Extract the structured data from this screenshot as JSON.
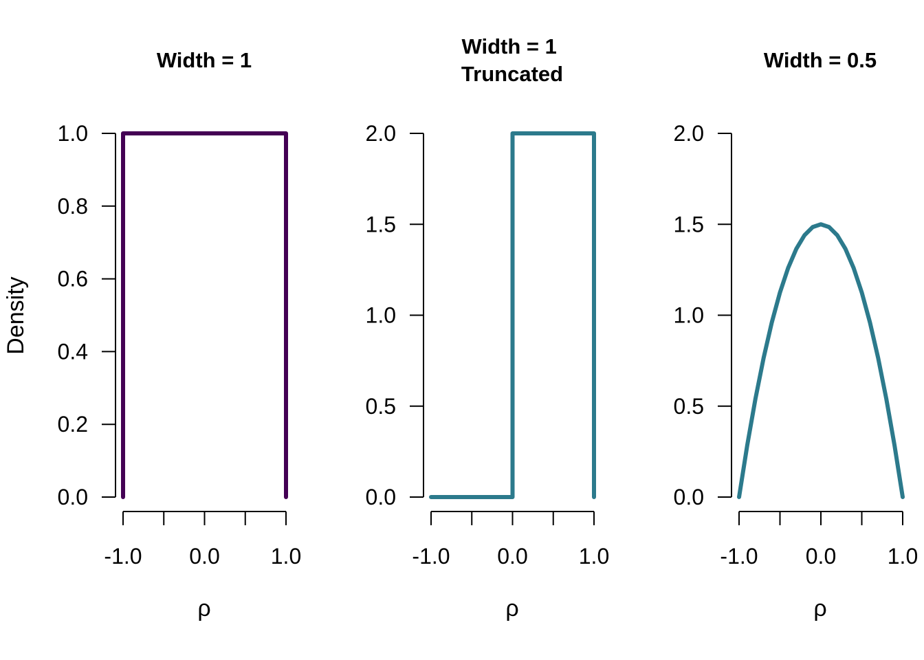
{
  "chart_data": [
    {
      "type": "line",
      "title": "Width = 1",
      "xlabel": "ρ",
      "ylabel": "Density",
      "xlim": [
        -1,
        1
      ],
      "ylim": [
        0,
        1
      ],
      "xticks": [
        -1,
        -0.5,
        0,
        0.5,
        1
      ],
      "xtick_labels": [
        "-1.0",
        "",
        "0.0",
        "",
        "1.0"
      ],
      "yticks": [
        0,
        0.2,
        0.4,
        0.6,
        0.8,
        1.0
      ],
      "ytick_labels": [
        "0.0",
        "0.2",
        "0.4",
        "0.6",
        "0.8",
        "1.0"
      ],
      "color": "#440154",
      "series": [
        {
          "name": "Width = 1",
          "x": [
            -1,
            -1,
            1,
            1
          ],
          "y": [
            0,
            1,
            1,
            0
          ]
        }
      ],
      "grid": false
    },
    {
      "type": "line",
      "title": "Width = 1\nTruncated",
      "title_lines": [
        "Width = 1",
        "Truncated"
      ],
      "xlabel": "ρ",
      "ylabel": "",
      "xlim": [
        -1,
        1
      ],
      "ylim": [
        0,
        2
      ],
      "xticks": [
        -1,
        -0.5,
        0,
        0.5,
        1
      ],
      "xtick_labels": [
        "-1.0",
        "",
        "0.0",
        "",
        "1.0"
      ],
      "yticks": [
        0,
        0.5,
        1.0,
        1.5,
        2.0
      ],
      "ytick_labels": [
        "0.0",
        "0.5",
        "1.0",
        "1.5",
        "2.0"
      ],
      "color": "#2c7a8c",
      "series": [
        {
          "name": "Width = 1 Truncated",
          "x": [
            -1,
            0,
            0,
            1,
            1
          ],
          "y": [
            0,
            0,
            2,
            2,
            0
          ]
        }
      ],
      "grid": false
    },
    {
      "type": "line",
      "title": "Width = 0.5",
      "xlabel": "ρ",
      "ylabel": "",
      "xlim": [
        -1,
        1
      ],
      "ylim": [
        0,
        2
      ],
      "xticks": [
        -1,
        -0.5,
        0,
        0.5,
        1
      ],
      "xtick_labels": [
        "-1.0",
        "",
        "0.0",
        "",
        "1.0"
      ],
      "yticks": [
        0,
        0.5,
        1.0,
        1.5,
        2.0
      ],
      "ytick_labels": [
        "0.0",
        "0.5",
        "1.0",
        "1.5",
        "2.0"
      ],
      "color": "#2c7a8c",
      "series": [
        {
          "name": "Width = 0.5",
          "x": [
            -1,
            -0.9,
            -0.8,
            -0.7,
            -0.6,
            -0.5,
            -0.4,
            -0.3,
            -0.2,
            -0.1,
            0,
            0.1,
            0.2,
            0.3,
            0.4,
            0.5,
            0.6,
            0.7,
            0.8,
            0.9,
            1
          ],
          "y": [
            0,
            0.285,
            0.54,
            0.765,
            0.96,
            1.125,
            1.26,
            1.365,
            1.44,
            1.485,
            1.5,
            1.485,
            1.44,
            1.365,
            1.26,
            1.125,
            0.96,
            0.765,
            0.54,
            0.285,
            0
          ]
        }
      ],
      "grid": false
    }
  ]
}
